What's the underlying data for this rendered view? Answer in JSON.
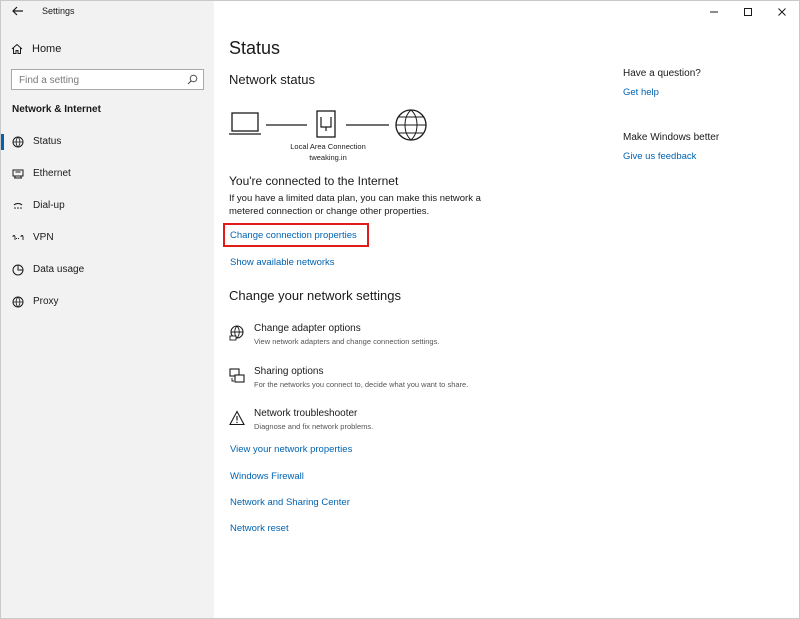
{
  "app": {
    "title": "Settings"
  },
  "sidebar": {
    "home_label": "Home",
    "search_placeholder": "Find a setting",
    "section_label": "Network & Internet",
    "items": [
      {
        "label": "Status",
        "icon": "globe-monitor-icon",
        "active": true
      },
      {
        "label": "Ethernet",
        "icon": "ethernet-icon",
        "active": false
      },
      {
        "label": "Dial-up",
        "icon": "dial-up-icon",
        "active": false
      },
      {
        "label": "VPN",
        "icon": "vpn-icon",
        "active": false
      },
      {
        "label": "Data usage",
        "icon": "data-usage-icon",
        "active": false
      },
      {
        "label": "Proxy",
        "icon": "globe-icon",
        "active": false
      }
    ]
  },
  "main": {
    "page_title": "Status",
    "network_status_heading": "Network status",
    "diagram": {
      "connection_name": "Local Area Connection",
      "network_name": "tweaking.in"
    },
    "connected_heading": "You're connected to the Internet",
    "connected_desc": "If you have a limited data plan, you can make this network a metered connection or change other properties.",
    "change_connection_link": "Change connection properties",
    "show_networks_link": "Show available networks",
    "change_settings_heading": "Change your network settings",
    "settings": [
      {
        "title": "Change adapter options",
        "desc": "View network adapters and change connection settings.",
        "icon": "adapter-globe-icon"
      },
      {
        "title": "Sharing options",
        "desc": "For the networks you connect to, decide what you want to share.",
        "icon": "sharing-icon"
      },
      {
        "title": "Network troubleshooter",
        "desc": "Diagnose and fix network problems.",
        "icon": "warning-icon"
      }
    ],
    "bottom_links": [
      "View your network properties",
      "Windows Firewall",
      "Network and Sharing Center",
      "Network reset"
    ]
  },
  "side_panel": {
    "question_heading": "Have a question?",
    "help_link": "Get help",
    "better_heading": "Make Windows better",
    "feedback_link": "Give us feedback"
  },
  "colors": {
    "accent": "#0063b1",
    "highlight": "#e21b1b",
    "sidebar_bg": "#f2f2f2"
  }
}
